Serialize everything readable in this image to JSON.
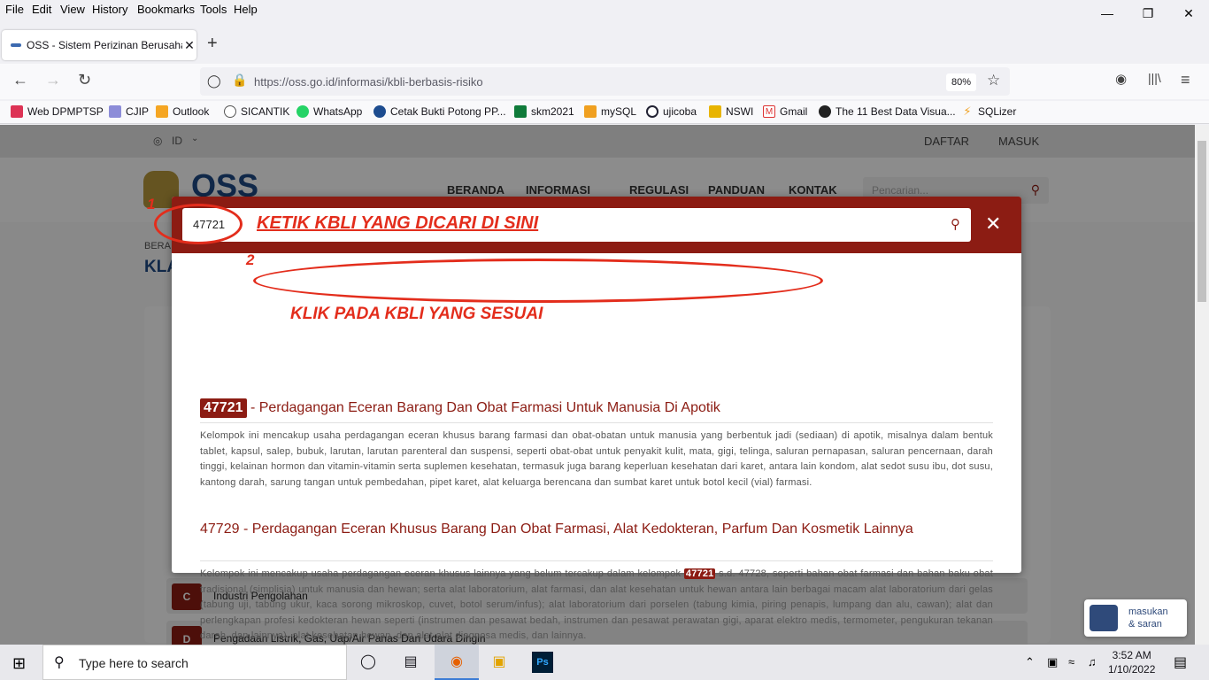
{
  "browser": {
    "menu": [
      "File",
      "Edit",
      "View",
      "History",
      "Bookmarks",
      "Tools",
      "Help"
    ],
    "tab_title": "OSS - Sistem Perizinan Berusaha",
    "url": "https://oss.go.id/informasi/kbli-berbasis-risiko",
    "zoom": "80%",
    "bookmarks": [
      "Web DPMPTSP",
      "CJIP",
      "Outlook",
      "SICANTIK",
      "WhatsApp",
      "Cetak Bukti Potong PP...",
      "skm2021",
      "mySQL",
      "ujicoba",
      "NSWI",
      "Gmail",
      "The 11 Best Data Visua...",
      "SQLizer"
    ]
  },
  "site": {
    "lang": "ID",
    "daftar": "DAFTAR",
    "masuk": "MASUK",
    "logo": "OSS",
    "nav": [
      "BERANDA",
      "INFORMASI",
      "REGULASI",
      "PANDUAN",
      "KONTAK"
    ],
    "search_placeholder": "Pencarian...",
    "breadcrumb_stub": "BERA",
    "heading_stub": "KLA",
    "sectors": [
      {
        "code": "C",
        "label": "Industri Pengolahan"
      },
      {
        "code": "D",
        "label": "Pengadaan Listrik, Gas, Uap/Air Panas Dan Udara Dingin"
      }
    ],
    "feedback": [
      "masukan",
      "& saran"
    ]
  },
  "modal": {
    "search_value": "47721",
    "results": [
      {
        "code": "47721",
        "title": " - Perdagangan Eceran Barang Dan Obat Farmasi Untuk Manusia Di Apotik",
        "desc": "Kelompok ini mencakup usaha perdagangan eceran khusus barang farmasi dan obat-obatan untuk manusia yang berbentuk jadi (sediaan) di apotik, misalnya dalam bentuk tablet, kapsul, salep, bubuk, larutan, larutan parenteral dan suspensi, seperti obat-obat untuk penyakit kulit, mata, gigi, telinga, saluran pernapasan, saluran pencernaan, darah tinggi, kelainan hormon dan vitamin-vitamin serta suplemen kesehatan, termasuk juga barang keperluan kesehatan dari karet, antara lain kondom, alat sedot susu ibu, dot susu, kantong darah, sarung tangan untuk pembedahan, pipet karet, alat keluarga berencana dan sumbat karet untuk botol kecil (vial) farmasi."
      },
      {
        "title": "47729 - Perdagangan Eceran Khusus Barang Dan Obat Farmasi, Alat Kedokteran, Parfum Dan Kosmetik Lainnya",
        "desc_pre": "Kelompok ini mencakup usaha perdagangan eceran khusus lainnya yang belum tercakup dalam kelompok ",
        "desc_code": "47721",
        "desc_post": " s.d. 47728, seperti bahan obat farmasi dan bahan baku obat tradisional (simplisia) untuk manusia dan hewan; serta alat laboratorium, alat farmasi, dan alat kesehatan untuk hewan antara lain berbagai macam alat laboratorium dari gelas (tabung uji, tabung ukur, kaca sorong mikroskop, cuvet, botol serum/infus); alat laboratorium dari porselen (tabung kimia, piring penapis, lumpang dan alu, cawan); alat dan perlengkapan profesi kedokteran hewan seperti (instrumen dan pesawat bedah, instrumen dan pesawat perawatan gigi, aparat elektro medis, termometer, pengukuran tekanan darah, dan lainnya), alat kesehatan hewan, dan alat-alat diagnosa medis, dan lainnya."
      }
    ]
  },
  "annotations": {
    "num1": "1",
    "num2": "2",
    "type_hint": "KETIK KBLI YANG DICARI DI SINI",
    "click_hint": "KLIK PADA KBLI YANG SESUAI"
  },
  "taskbar": {
    "search_text": "Type here to search",
    "time": "3:52 AM",
    "date": "1/10/2022"
  }
}
